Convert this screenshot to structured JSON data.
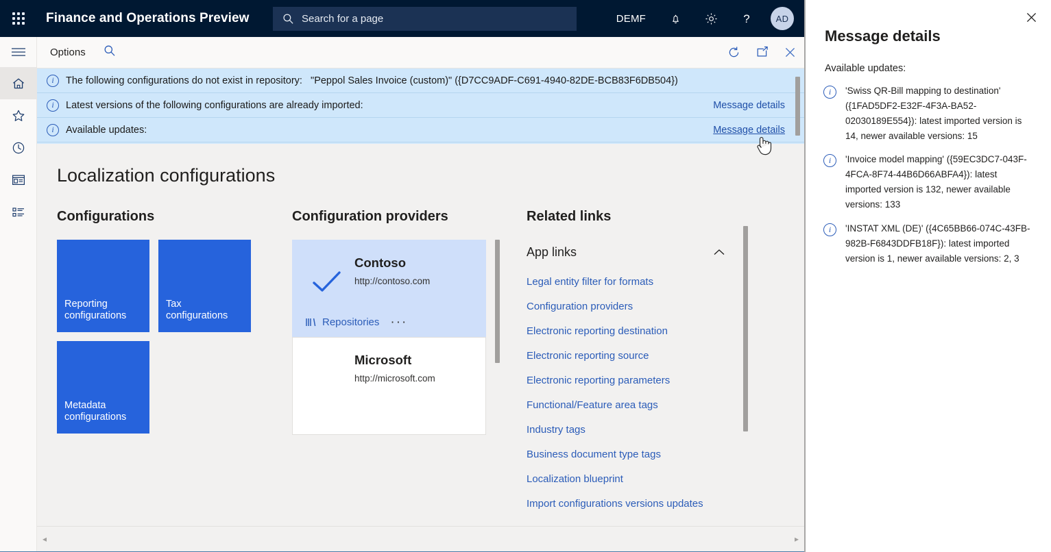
{
  "topbar": {
    "waffle_icon": "app-launcher-icon",
    "app_title": "Finance and Operations Preview",
    "search_placeholder": "Search for a page",
    "search_icon": "search-icon",
    "company": "DEMF",
    "notifications_icon": "bell-icon",
    "settings_icon": "gear-icon",
    "help_icon": "question-mark-icon",
    "avatar_initials": "AD"
  },
  "rail": {
    "items": [
      {
        "icon": "hamburger-icon",
        "name": "navigation-menu"
      },
      {
        "icon": "home-icon",
        "name": "home"
      },
      {
        "icon": "star-icon",
        "name": "favorites"
      },
      {
        "icon": "clock-icon",
        "name": "recent"
      },
      {
        "icon": "workspace-icon",
        "name": "workspaces"
      },
      {
        "icon": "modules-list-icon",
        "name": "modules"
      }
    ]
  },
  "commandbar": {
    "options_label": "Options",
    "search_icon": "search-icon",
    "refresh_icon": "refresh-icon",
    "popout_icon": "open-in-new-window-icon",
    "close_icon": "close-icon"
  },
  "messagebar": {
    "messages": [
      {
        "icon": "info-icon",
        "text": "The following configurations do not exist in repository:   \"Peppol Sales Invoice (custom)\" ({D7CC9ADF-C691-4940-82DE-BCB83F6DB504})",
        "link": ""
      },
      {
        "icon": "info-icon",
        "text": "Latest versions of the following configurations are already imported:",
        "link": "Message details"
      },
      {
        "icon": "info-icon",
        "text": "Available updates:",
        "link": "Message details"
      }
    ]
  },
  "main": {
    "page_title": "Localization configurations",
    "configurations": {
      "heading": "Configurations",
      "tiles": [
        {
          "label": "Reporting configurations"
        },
        {
          "label": "Tax configurations"
        },
        {
          "label": "Metadata configurations"
        }
      ]
    },
    "providers": {
      "heading": "Configuration providers",
      "items": [
        {
          "name": "Contoso",
          "url": "http://contoso.com",
          "selected": true,
          "check_icon": "checkmark-icon",
          "repositories_label": "Repositories",
          "repositories_icon": "books-icon",
          "more_label": "···"
        },
        {
          "name": "Microsoft",
          "url": "http://microsoft.com",
          "selected": false
        }
      ]
    },
    "related_links": {
      "heading": "Related links",
      "group_label": "App links",
      "collapse_icon": "chevron-up-icon",
      "links": [
        "Legal entity filter for formats",
        "Configuration providers",
        "Electronic reporting destination",
        "Electronic reporting source",
        "Electronic reporting parameters",
        "Functional/Feature area tags",
        "Industry tags",
        "Business document type tags",
        "Localization blueprint",
        "Import configurations versions updates"
      ]
    }
  },
  "hscroll": {
    "left_arrow": "◂",
    "right_arrow": "▸"
  },
  "panel": {
    "close_icon": "close-icon",
    "title": "Message details",
    "subtitle": "Available updates:",
    "items": [
      {
        "icon": "info-icon",
        "text": "'Swiss QR-Bill mapping to destination' ({1FAD5DF2-E32F-4F3A-BA52-02030189E554}): latest imported version is 14, newer available versions: 15"
      },
      {
        "icon": "info-icon",
        "text": "'Invoice model mapping' ({59EC3DC7-043F-4FCA-8F74-44B6D66ABFA4}): latest imported version is 132, newer available versions: 133"
      },
      {
        "icon": "info-icon",
        "text": "'INSTAT XML (DE)' ({4C65BB66-074C-43FB-982B-F6843DDFB18F}): latest imported version is 1, newer available versions: 2, 3"
      }
    ]
  },
  "colors": {
    "nav_bg": "#001832",
    "tile_blue": "#2663dc",
    "link_blue": "#2b5cb8",
    "message_bg": "#cfe7fb",
    "selected_card": "#cfdffa",
    "content_bg": "#f2f1f0"
  }
}
